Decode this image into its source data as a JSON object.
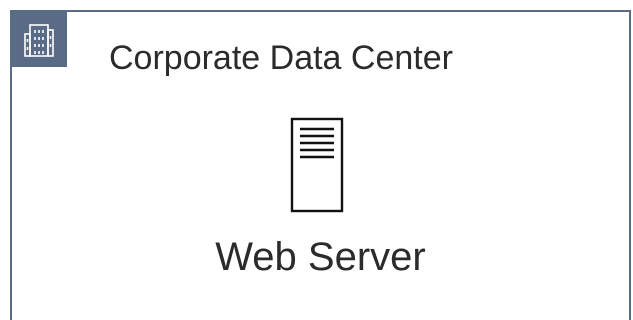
{
  "group": {
    "title": "Corporate Data Center",
    "icon": "building-icon",
    "border_color": "#5a6b86"
  },
  "node": {
    "label": "Web Server",
    "icon": "server-icon"
  }
}
